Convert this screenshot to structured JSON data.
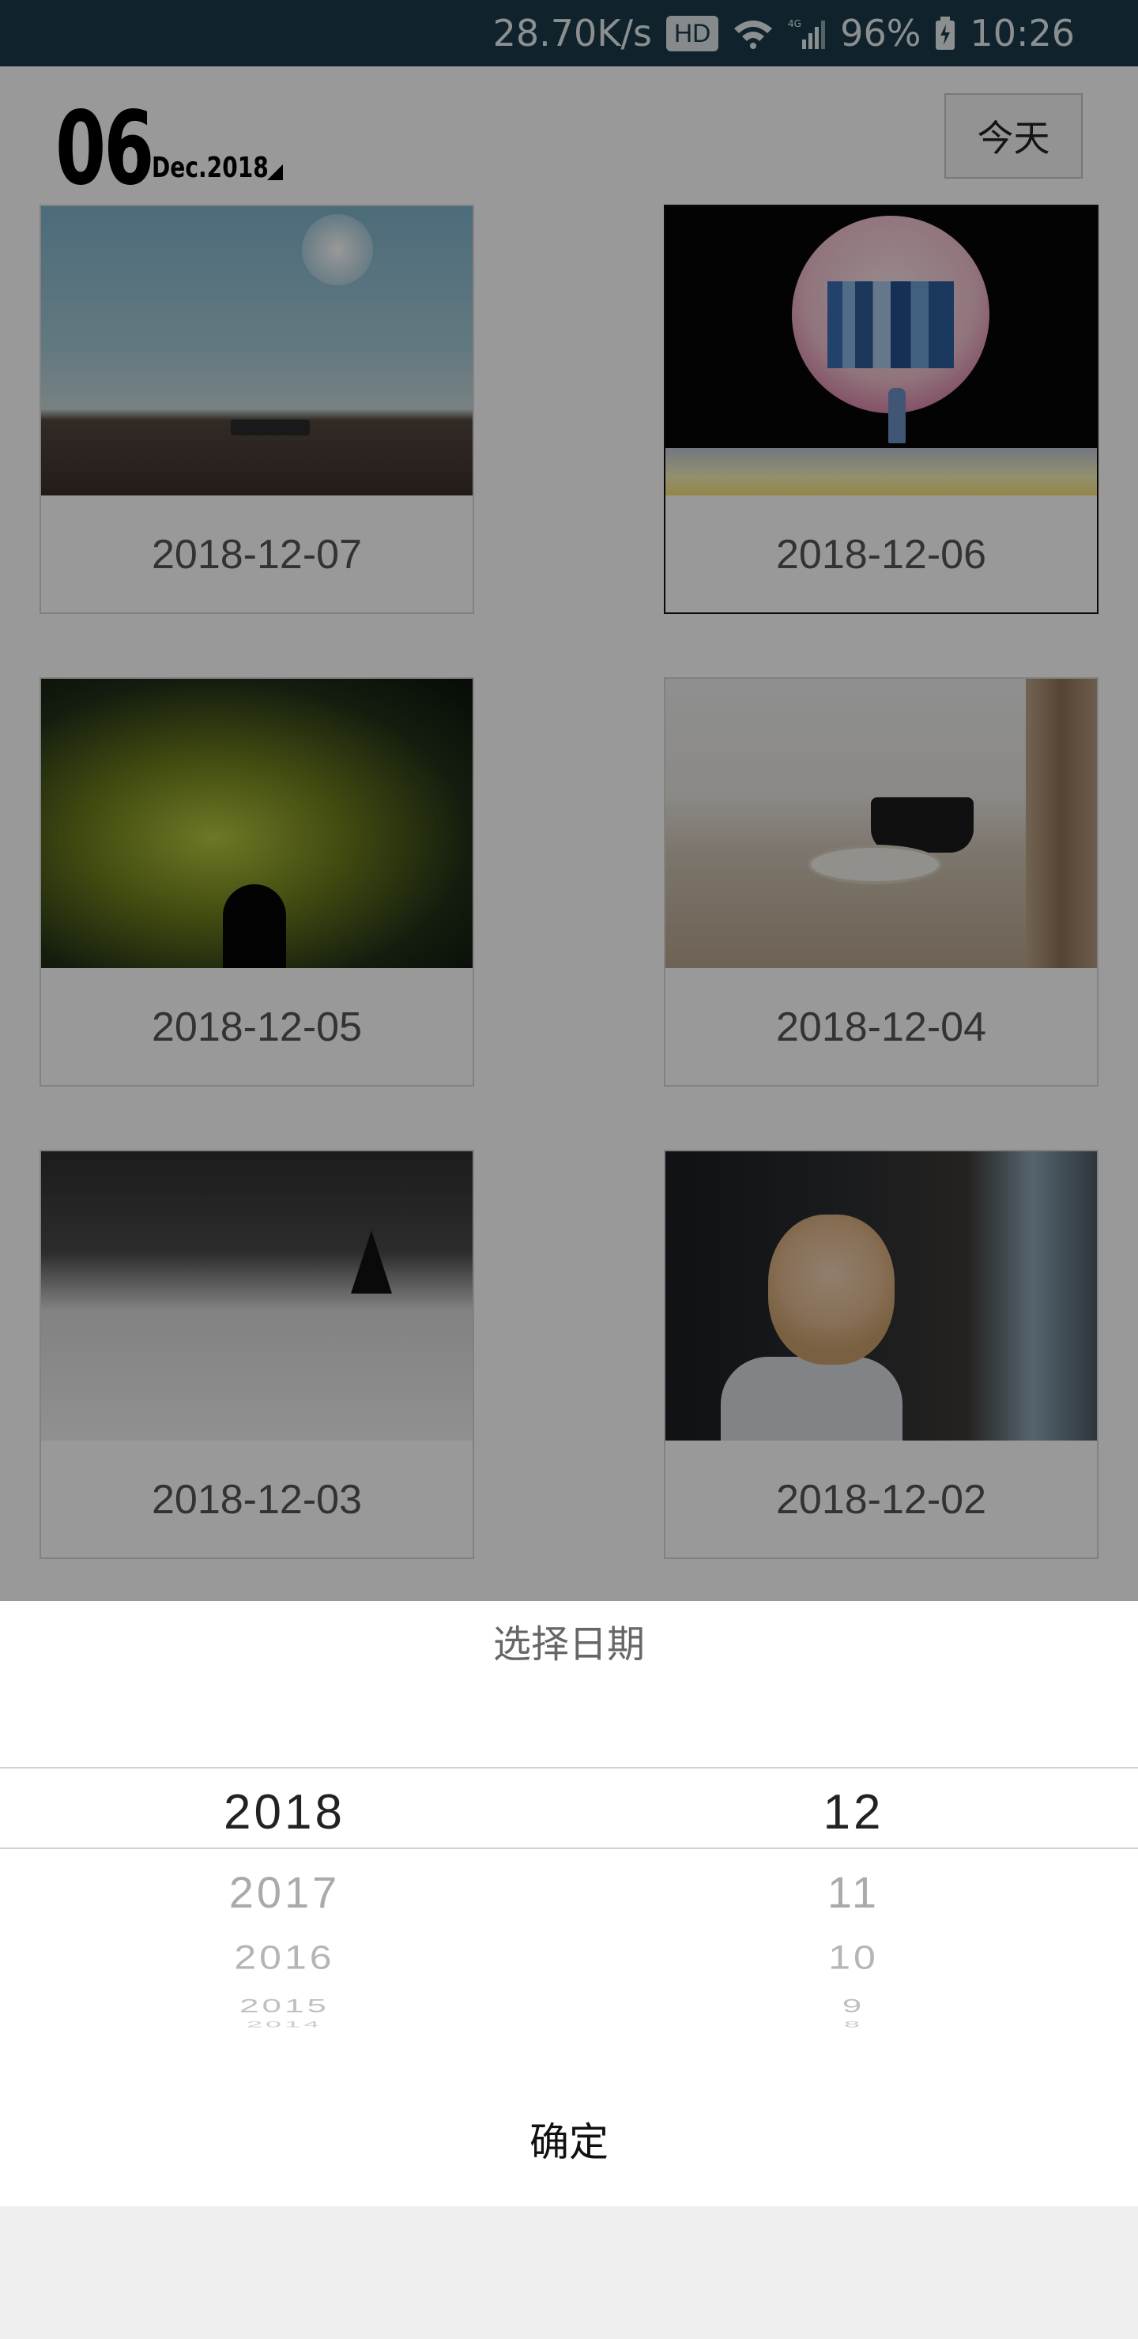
{
  "status_bar": {
    "net_speed": "28.70K/s",
    "hd": "HD",
    "battery": "96%",
    "time": "10:26"
  },
  "header": {
    "day": "06",
    "month_year": "Dec.2018",
    "today_label": "今天"
  },
  "cards": [
    {
      "date": "2018-12-07"
    },
    {
      "date": "2018-12-06"
    },
    {
      "date": "2018-12-05"
    },
    {
      "date": "2018-12-04"
    },
    {
      "date": "2018-12-03"
    },
    {
      "date": "2018-12-02"
    }
  ],
  "date_picker": {
    "title": "选择日期",
    "years": [
      "2018",
      "2017",
      "2016",
      "2015",
      "2014"
    ],
    "months": [
      "12",
      "11",
      "10",
      "9",
      "8"
    ],
    "selected_year": "2018",
    "selected_month": "12",
    "confirm_label": "确定"
  }
}
